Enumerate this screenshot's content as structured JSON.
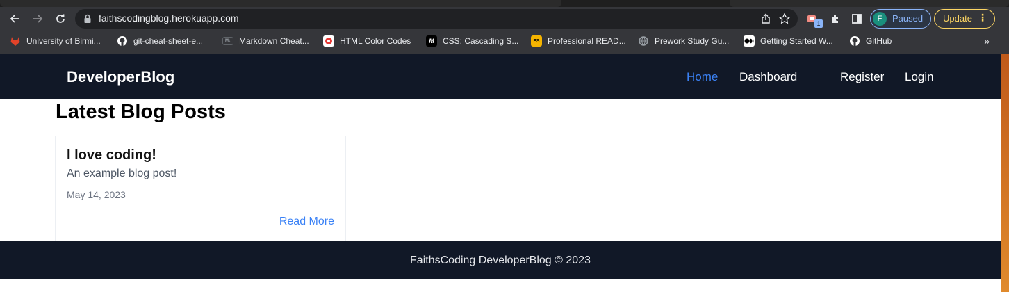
{
  "browser": {
    "url": "faithscodingblog.herokuapp.com",
    "profile_initial": "F",
    "profile_status": "Paused",
    "update_label": "Update",
    "extension_badge": "1",
    "more_bookmarks": "»",
    "bookmarks": [
      {
        "label": "University of Birmi...",
        "icon": "gitlab-icon",
        "color": "#e24329"
      },
      {
        "label": "git-cheat-sheet-e...",
        "icon": "github-icon",
        "color": "#ffffff"
      },
      {
        "label": "Markdown Cheat...",
        "icon": "markdown-icon",
        "color": "#5f6368"
      },
      {
        "label": "HTML Color Codes",
        "icon": "color-wheel-icon",
        "color": "#e53935"
      },
      {
        "label": "CSS: Cascading S...",
        "icon": "mdn-icon",
        "color": "#000000"
      },
      {
        "label": "Professional READ...",
        "icon": "readme-icon",
        "color": "#f5b400"
      },
      {
        "label": "Prework Study Gu...",
        "icon": "globe-icon",
        "color": "#9aa0a6"
      },
      {
        "label": "Getting Started W...",
        "icon": "medium-icon",
        "color": "#ffffff"
      },
      {
        "label": "GitHub",
        "icon": "github-icon",
        "color": "#ffffff"
      }
    ]
  },
  "site": {
    "brand": "DeveloperBlog",
    "nav": {
      "home": "Home",
      "dashboard": "Dashboard",
      "register": "Register",
      "login": "Login"
    },
    "accent_color": "#3b82f6",
    "nav_bg": "#111827"
  },
  "main": {
    "heading": "Latest Blog Posts",
    "posts": [
      {
        "title": "I love coding!",
        "description": "An example blog post!",
        "date": "May 14, 2023",
        "read_more": "Read More"
      }
    ]
  },
  "footer": {
    "text": "FaithsCoding DeveloperBlog © 2023"
  }
}
